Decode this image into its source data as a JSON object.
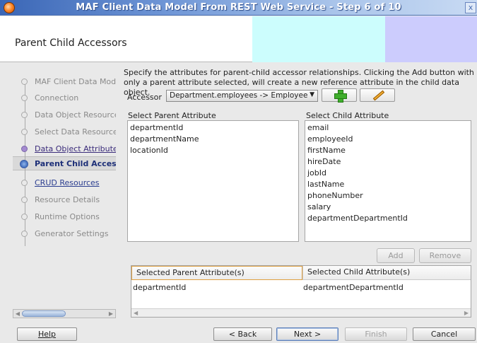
{
  "window": {
    "title": "MAF Client Data Model From REST Web Service - Step 6 of 10",
    "close_glyph": "x"
  },
  "header": {
    "title": "Parent Child Accessors"
  },
  "nav": {
    "items": [
      {
        "label": "MAF Client Data Model",
        "state": "default"
      },
      {
        "label": "Connection",
        "state": "default"
      },
      {
        "label": "Data Object Resources",
        "state": "default"
      },
      {
        "label": "Select Data Resources",
        "state": "default"
      },
      {
        "label": "Data Object Attributes",
        "state": "visited"
      },
      {
        "label": "Parent Child Accessors",
        "state": "current"
      },
      {
        "label": "CRUD Resources",
        "state": "link"
      },
      {
        "label": "Resource Details",
        "state": "default"
      },
      {
        "label": "Runtime Options",
        "state": "default"
      },
      {
        "label": "Generator Settings",
        "state": "default"
      }
    ]
  },
  "main": {
    "description": "Specify the attributes for parent-child accessor relationships. Clicking the Add button with only a parent attribute selected, will create a new reference attribute in the child data object.",
    "accessor_label": "Accessor",
    "accessor_value": "Department.employees -> Employee",
    "parent_label": "Select Parent Attribute",
    "child_label": "Select Child Attribute",
    "parent_attributes": [
      "departmentId",
      "departmentName",
      "locationId"
    ],
    "child_attributes": [
      "email",
      "employeeId",
      "firstName",
      "hireDate",
      "jobId",
      "lastName",
      "phoneNumber",
      "salary",
      "departmentDepartmentId"
    ],
    "add_label": "Add",
    "remove_label": "Remove",
    "table": {
      "headers": [
        "Selected Parent Attribute(s)",
        "Selected Child Attribute(s)"
      ],
      "rows": [
        [
          "departmentId",
          "departmentDepartmentId"
        ]
      ]
    }
  },
  "footer": {
    "help_label": "Help",
    "back_label": "< Back",
    "next_label": "Next >",
    "finish_label": "Finish",
    "cancel_label": "Cancel"
  },
  "colors": {
    "title_bar": "#3a66b6",
    "header_cyan": "#ccfdfd",
    "header_lilac": "#ccccfd",
    "current_step": "#4c78c4"
  },
  "icons": {
    "app": "oracle-orb-icon",
    "add_accessor": "plus-icon",
    "edit_accessor": "pencil-icon"
  }
}
